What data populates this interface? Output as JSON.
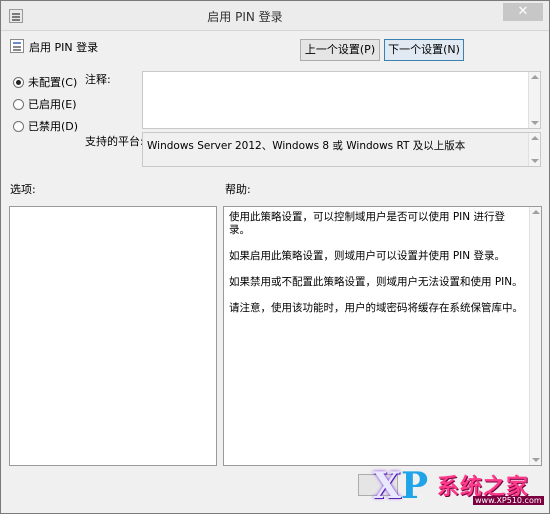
{
  "window": {
    "title": "启用 PIN 登录",
    "close_glyph": "✕"
  },
  "policy": {
    "name": "启用 PIN 登录"
  },
  "nav": {
    "prev_label": "上一个设置(P)",
    "next_label": "下一个设置(N)"
  },
  "state": {
    "options": [
      {
        "label": "未配置(C)",
        "checked": true
      },
      {
        "label": "已启用(E)",
        "checked": false
      },
      {
        "label": "已禁用(D)",
        "checked": false
      }
    ]
  },
  "comment": {
    "label": "注释:",
    "value": ""
  },
  "platform": {
    "label": "支持的平台:",
    "value": "Windows Server 2012、Windows 8 或 Windows RT 及以上版本"
  },
  "options_section": {
    "label": "选项:"
  },
  "help_section": {
    "label": "帮助:",
    "paragraphs": [
      "使用此策略设置，可以控制域用户是否可以使用 PIN 进行登录。",
      "如果启用此策略设置，则域用户可以设置并使用 PIN 登录。",
      "如果禁用或不配置此策略设置，则域用户无法设置和使用 PIN。",
      "请注意，使用该功能时，用户的域密码将缓存在系统保管库中。"
    ]
  },
  "watermark": {
    "letters": "XP",
    "brand": "系统之家",
    "url": "www.XP510.com"
  }
}
